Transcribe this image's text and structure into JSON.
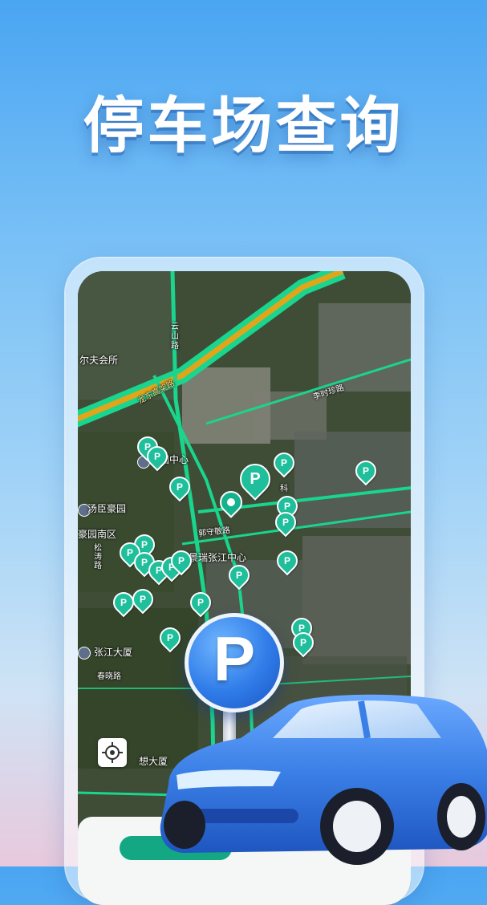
{
  "headline": "停车场查询",
  "map": {
    "labels": {
      "golf": "尔夫会所",
      "yunshan_rd": "云山路",
      "longdong": "龙东高架路",
      "lishi_rd": "李时珍路",
      "guoguo": "国中心",
      "tangchen": "汤臣豪园",
      "haoyuan_south": "豪园南区",
      "songtao": "松涛路",
      "guoshoujing": "郭守敬路",
      "jingrui": "景瑞张江中心",
      "zhangjiang": "张江大厦",
      "chunxiao": "春晓路",
      "lixiang": "想大厦",
      "ke": "科"
    },
    "parking_marker_label": "P"
  },
  "hero_sign": "P",
  "colors": {
    "accent": "#1fbf9b",
    "sign_blue": "#2f7ce8",
    "car_blue": "#3a7fe6"
  },
  "icons": {
    "locate": "crosshair-icon",
    "building": "building-poi-icon"
  }
}
